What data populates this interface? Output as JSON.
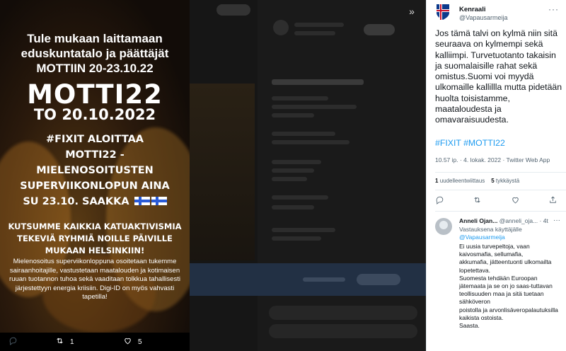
{
  "poster": {
    "heading_line1": "Tule mukaan laittamaan",
    "heading_line2": "eduskuntatalo ja päättäjät",
    "heading_line3": "MOTTIIN 20-23.10.22",
    "motti": "MOTTI22",
    "date": "TO 20.10.2022",
    "hash_line1": "#FIXIT ALOITTAA",
    "hash_line2": "MOTTI22 -",
    "hash_line3": "MIELENOSOITUSTEN",
    "hash_line4": "SUPERVIIKONLOPUN AINA",
    "hash_line5": "SU 23.10. SAAKKA",
    "invite_line1": "KUTSUMME KAIKKIA KATUAKTIVISMIA",
    "invite_line2": "TEKEVIÄ RYHMIÄ NOILLE PÄIVILLE",
    "invite_line3": "MUKAAN HELSINKIIN!",
    "body_text": "Mielenosoitus superviikonloppuna osoitetaan tukemme sairaanhoitajille, vastustetaan maatalouden ja kotimaisen ruuan tuotannon tuhoa sekä vaaditaan tolkkua tahallisesti järjestettyyn energia kriisiin. Digi-ID on myös vahvasti tapetilla!"
  },
  "poster_actions": {
    "retweet_count": "1",
    "like_count": "5"
  },
  "tweet": {
    "author_name": "Kenraali",
    "author_handle": "@Vapausarmeija",
    "more_label": "···",
    "text": "Jos tämä talvi on kylmä niin sitä seuraava on kylmempi sekä kalliimpi. Turvetuotanto takaisin ja suomalaisille rahat sekä omistus.Suomi voi myydä ulkomaille kallillla mutta pidetään huolta toisistamme, maataloudesta ja omavaraisuudesta.",
    "hashtags": "#FIXIT #MOTTI22",
    "meta": "10.57 ip. · 4. lokak. 2022 · Twitter Web App",
    "retweets_count": "1",
    "retweets_label": "uudelleentwiittaus",
    "likes_count": "5",
    "likes_label": "tykkäystä"
  },
  "reply": {
    "author_name": "Anneli Ojan...",
    "author_handle": "@anneli_oja...",
    "time": "· 4t",
    "more_label": "···",
    "reply_prefix": "Vastauksena käyttäjälle",
    "reply_to": "@Vapausarmeija",
    "text": "Ei uusia turvepeltoja, vaan\nkaivosmafia, sellumafia,\nakkumafia, jätteentuonti ulkomailta\nlopetettava.\nSuomesta tehdään Euroopan\njätemaata ja se on jo saas-tuttavan\nteollisuuden maa ja sitä tuetaan\nsähköveron\npoistolla ja arvonlisäveropalautuksilla\nkaikista ostoista.\nSaasta."
  },
  "colors": {
    "accent": "#1d9bf0",
    "panel_bg": "#ffffff",
    "dim_bg": "#141414"
  }
}
